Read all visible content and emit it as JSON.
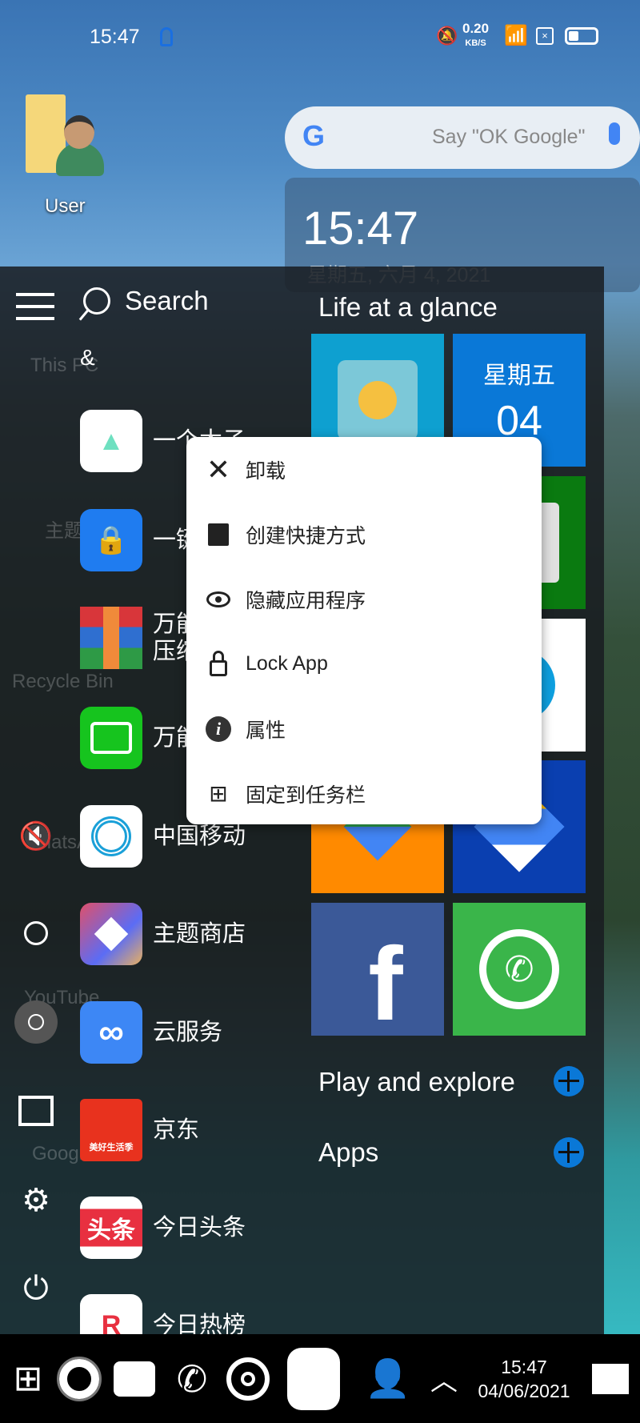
{
  "status_bar": {
    "time": "15:47",
    "net_speed": "0.20",
    "net_unit": "KB/S"
  },
  "desktop": {
    "icons": [
      {
        "label": "User"
      },
      {
        "label": "This PC"
      },
      {
        "label": "主题"
      },
      {
        "label": "Recycle Bin"
      },
      {
        "label": "WhatsApp"
      },
      {
        "label": "YouTube"
      },
      {
        "label": "Google"
      }
    ]
  },
  "google_bar": {
    "placeholder": "Say \"OK Google\""
  },
  "clock_widget": {
    "time": "15:47",
    "date": "星期五, 六月 4, 2021"
  },
  "start_menu": {
    "search_label": "Search",
    "section_letter": "&",
    "apps": [
      {
        "label": "一个木子",
        "color": "#ffffff"
      },
      {
        "label": "一键锁屏",
        "color": "#1f7cf0"
      },
      {
        "label": "万能\n压缩",
        "color": "#d8363a"
      },
      {
        "label": "万能钥匙",
        "color": "#16c41e"
      },
      {
        "label": "中国移动",
        "color": "#ffffff"
      },
      {
        "label": "主题商店",
        "color": "#5b6cf5"
      },
      {
        "label": "云服务",
        "color": "#3d87f5"
      },
      {
        "label": "京东",
        "color": "#e8321e"
      },
      {
        "label": "今日头条",
        "color": "#ffffff"
      },
      {
        "label": "今日热榜",
        "color": "#ffffff"
      }
    ],
    "jd_badge": "美好生活季",
    "toutiao_badge": "头条",
    "life_heading": "Life at a glance",
    "calendar_tile": {
      "weekday": "星期五",
      "day": "04"
    },
    "play_heading": "Play and explore",
    "apps_heading": "Apps"
  },
  "context_menu": {
    "items": [
      {
        "label": "卸载",
        "icon": "close-icon"
      },
      {
        "label": "创建快捷方式",
        "icon": "store-bag-icon"
      },
      {
        "label": "隐藏应用程序",
        "icon": "eye-icon"
      },
      {
        "label": "Lock App",
        "icon": "lock-icon"
      },
      {
        "label": "属性",
        "icon": "info-icon"
      },
      {
        "label": "固定到任务栏",
        "icon": "windows-icon"
      }
    ]
  },
  "taskbar": {
    "time": "15:47",
    "date": "04/06/2021"
  },
  "colors": {
    "accent": "#0a78d7",
    "facebook": "#3b5998",
    "whatsapp": "#3ab54a"
  }
}
